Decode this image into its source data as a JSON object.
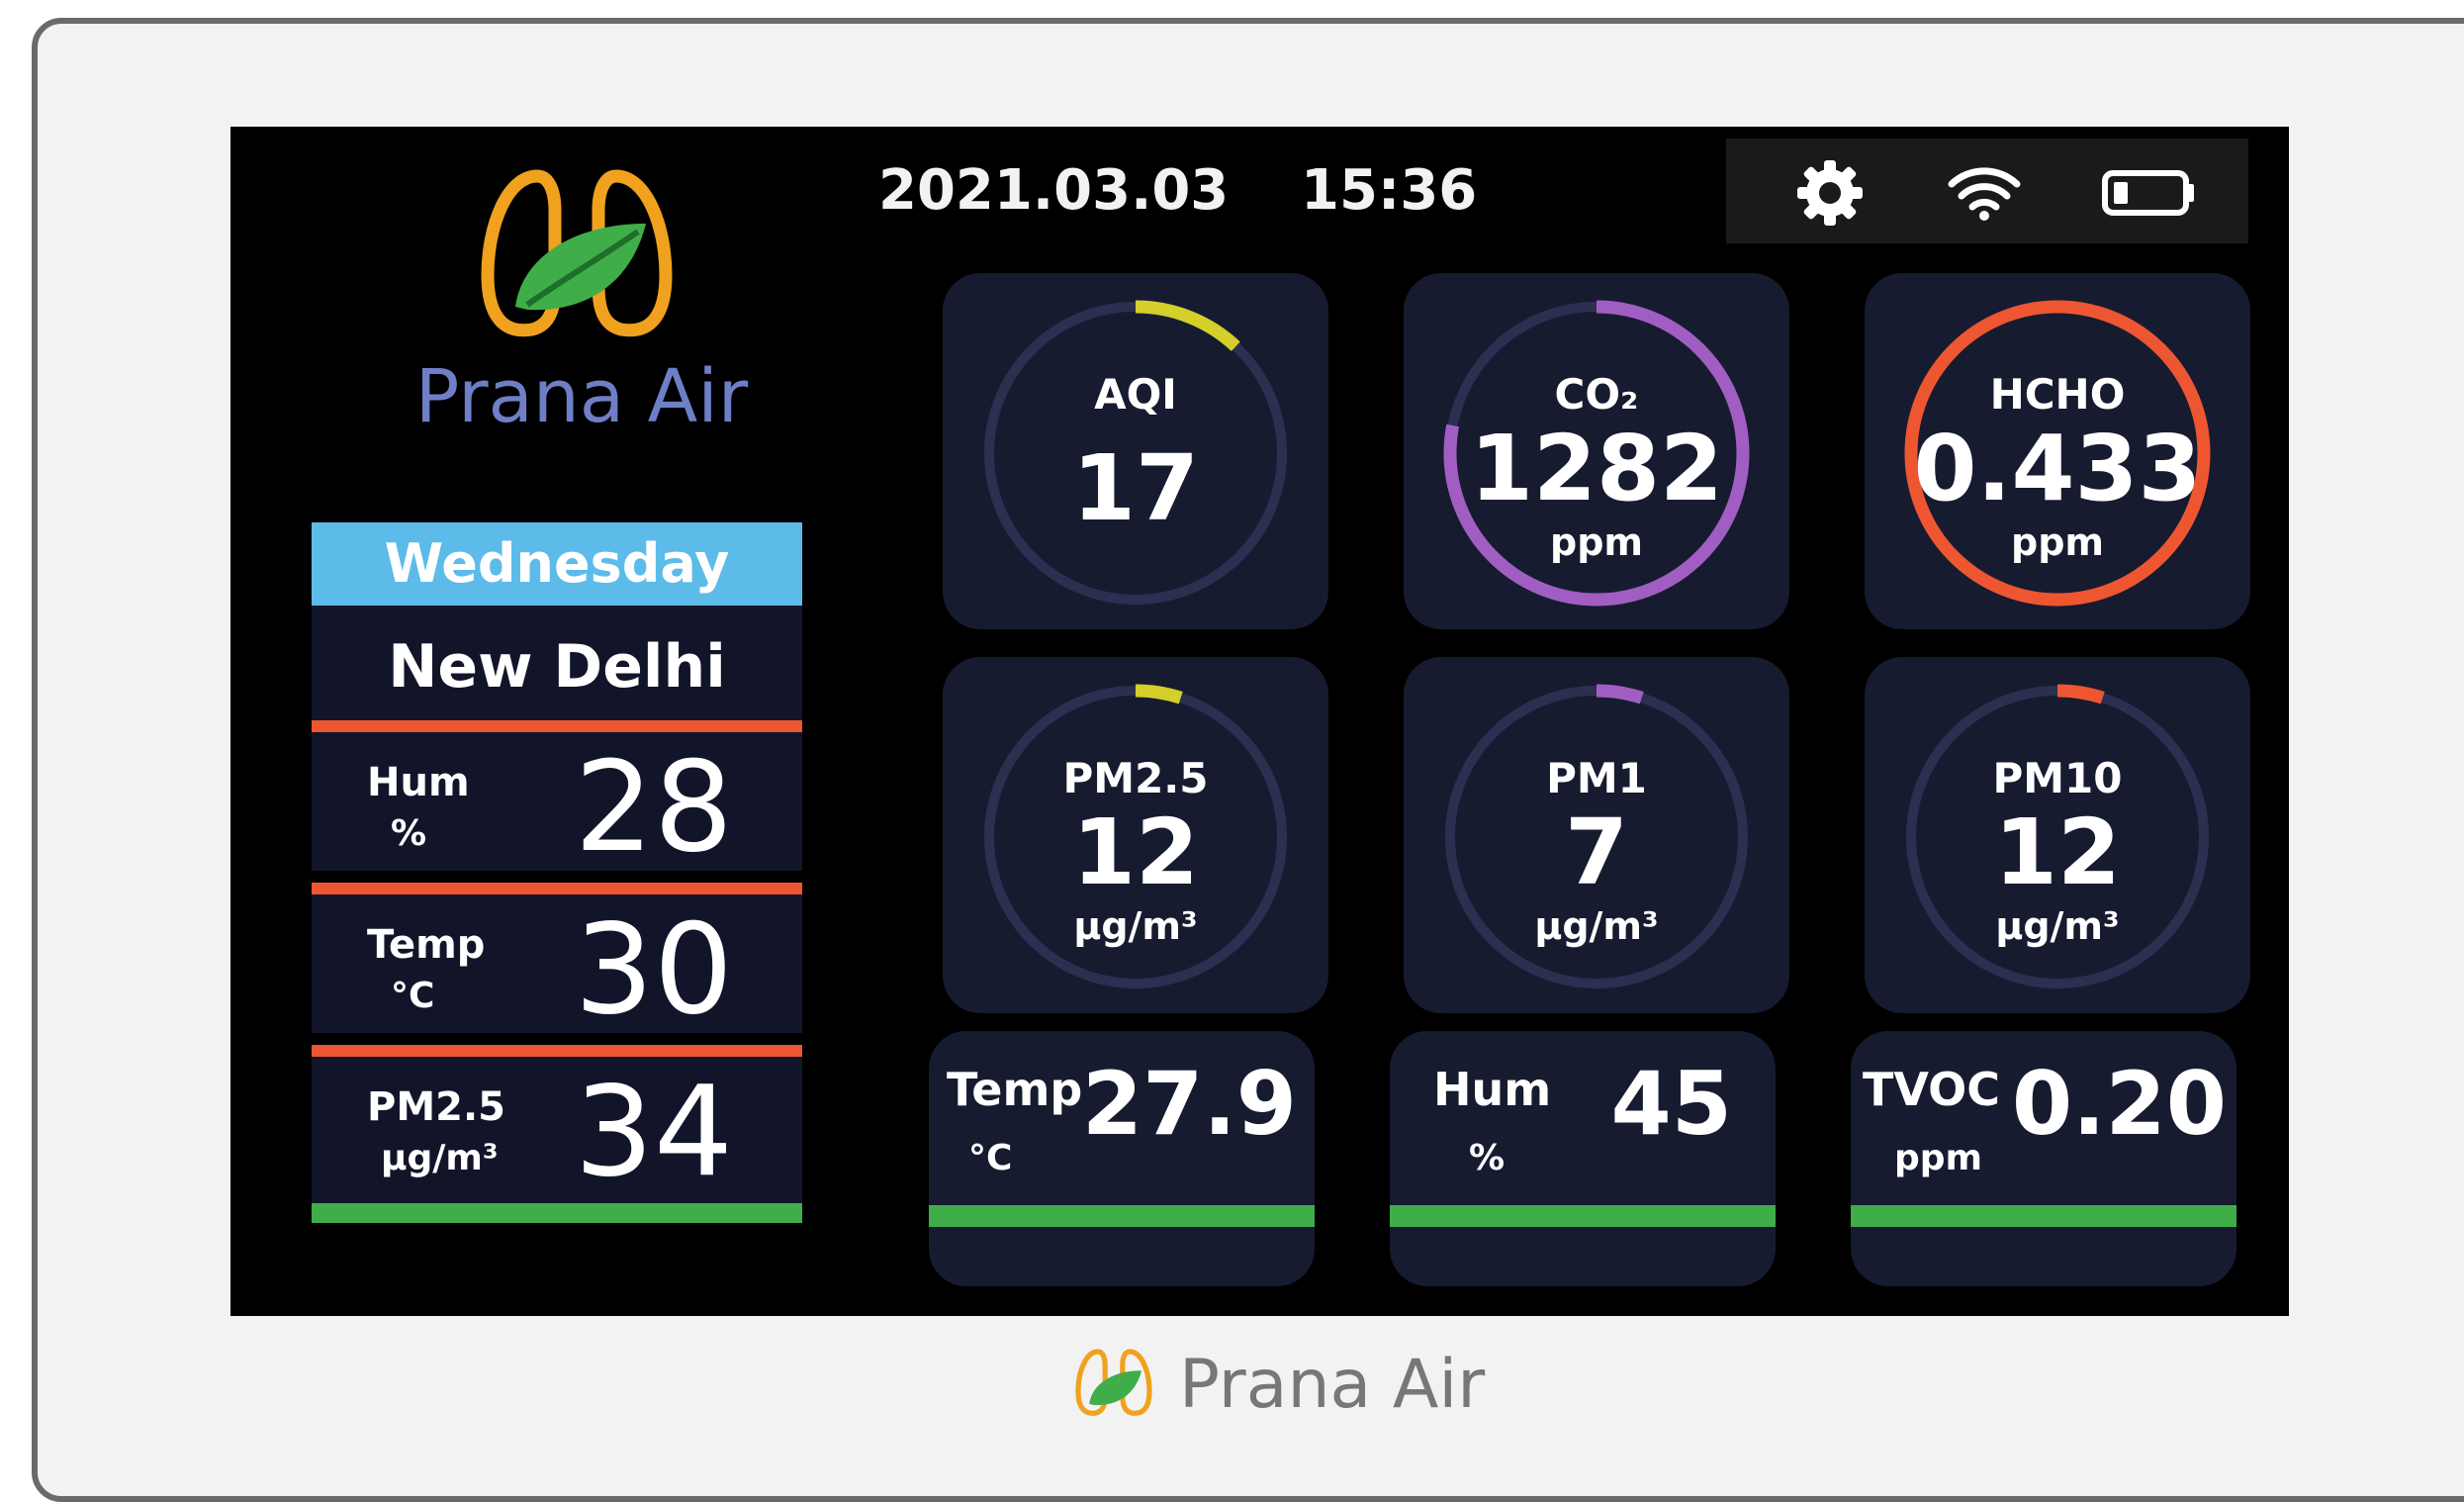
{
  "brand": {
    "name": "Prana Air"
  },
  "header": {
    "date": "2021.03.03",
    "time": "15:36"
  },
  "status_icons": [
    "gear-icon",
    "wifi-icon",
    "battery-icon"
  ],
  "outdoor": {
    "day": "Wednesday",
    "city": "New Delhi",
    "stats": [
      {
        "name": "Hum",
        "unit": "%",
        "value": "28"
      },
      {
        "name": "Temp",
        "unit": "°C",
        "value": "30"
      },
      {
        "name": "PM2.5",
        "unit": "µg/m³",
        "value": "34"
      }
    ]
  },
  "sensors": [
    {
      "label": "AQI",
      "value": "17",
      "unit": "",
      "color": "#d4cf2a",
      "fill": 0.12
    },
    {
      "label": "CO₂",
      "value": "1282",
      "unit": "ppm",
      "color": "#a15ec2",
      "fill": 0.78
    },
    {
      "label": "HCHO",
      "value": "0.433",
      "unit": "ppm",
      "color": "#ee5632",
      "fill": 1.0
    },
    {
      "label": "PM2.5",
      "value": "12",
      "unit": "µg/m³",
      "color": "#d4cf2a",
      "fill": 0.05
    },
    {
      "label": "PM1",
      "value": "7",
      "unit": "µg/m³",
      "color": "#a15ec2",
      "fill": 0.05
    },
    {
      "label": "PM10",
      "value": "12",
      "unit": "µg/m³",
      "color": "#ee5632",
      "fill": 0.05
    }
  ],
  "indoor": [
    {
      "name": "Temp",
      "unit": "°C",
      "value": "27.9"
    },
    {
      "name": "Hum",
      "unit": "%",
      "value": "45"
    },
    {
      "name": "TVOC",
      "unit": "ppm",
      "value": "0.20"
    }
  ],
  "colors": {
    "panel_bg": "#12152a",
    "card_bg": "#171b30",
    "separator": "#ee5632",
    "good": "#3fae49",
    "day_header": "#5dbbe9",
    "brand_text": "#6f7fc7"
  }
}
